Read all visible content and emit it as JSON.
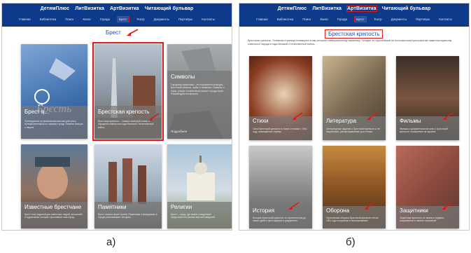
{
  "colors": {
    "header": "#0e3a8c",
    "highlight": "#e01919",
    "heading": "#1d4fae"
  },
  "panel_a": {
    "brand": [
      "ДетямПлюс",
      "ЛитВизитка",
      "АртВизитка",
      "Читающий бульвар"
    ],
    "nav": [
      "Главная",
      "Библиотека",
      "Поиск",
      "Книги",
      "Города",
      "Брест",
      "Театр",
      "Документы",
      "Партнёры",
      "Контакты"
    ],
    "heading": "Брест",
    "cards": [
      {
        "title": "Брест в...",
        "text": "Путеводитель по уникальным местам для юных путешественников по нашему городу. Узнайте больше о нашем",
        "art": "brest-emblem"
      },
      {
        "title": "Брестская крепость",
        "text": "Брестская крепость – Символ воинской славы и народной стойкости в годы Великой Отечественной войны",
        "art": "fortress-monument"
      },
      {
        "title": "Символы",
        "text": "Городская символика – это показатели культуры Брестской области, гербы и названия. Символы о горах, улицах и памятниках нашего города-героя. Рекомендуем посмотреть",
        "more": "Подробнее",
        "art": "symbols-monument"
      },
      {
        "title": "Известные брестчане",
        "text": "Брест стал родиной для известных людей, писателей и художников, которые прославили наш город.",
        "art": "veteran-portrait"
      },
      {
        "title": "Памятники",
        "text": "Брест помнит своих героев. Памятники и мемориалы в городе рассказывают историю.",
        "art": "monument-statues"
      },
      {
        "title": "Религии",
        "text": "Брест – город, где мирно соседствуют представители разных вероисповеданий.",
        "art": "church"
      }
    ]
  },
  "panel_b": {
    "brand": [
      "ДетямПлюс",
      "ЛитВизитка",
      "АртВизитка",
      "Читающий бульвар"
    ],
    "nav": [
      "Главная",
      "Библиотека",
      "Поиск",
      "Книги",
      "Города",
      "Брест",
      "Театр",
      "Документы",
      "Партнёры",
      "Контакты"
    ],
    "heading": "Брестская крепость",
    "intro": "Брестская крепость. Основная страница посвящена этому историко-мемориальному памятнику. Сегодня это крупнейший на постсоветском пространстве памятник мужеству советского народа в годы Великой Отечественной войны.",
    "cards": [
      {
        "title": "Стихи",
        "text": "Сила Брестской крепости в стихах и поэзии о 1941 году, посвящённых героям.",
        "art": "book-scroll"
      },
      {
        "title": "Литература",
        "text": "Литературные издания о Брестской крепости и её защитниках, рекомендованные для чтения.",
        "art": "literature-collage"
      },
      {
        "title": "Фильмы",
        "text": "Фильмы и документальное кино о Брестской крепости, показанные на экранах.",
        "art": "film-still"
      },
      {
        "title": "История",
        "text": "История Брестской крепости от строительства до наших дней в фотографиях и документах.",
        "art": "history-photo"
      },
      {
        "title": "Оборона",
        "text": "Героическая оборона Брестской крепости летом 1941 года в картинах и воспоминаниях.",
        "art": "defense-painting"
      },
      {
        "title": "Защитники",
        "text": "Защитники крепости, их имена и подвиги, сохранённые в памяти поколений.",
        "art": "defenders-wall"
      }
    ]
  },
  "labels": {
    "a": "а)",
    "b": "б)"
  }
}
